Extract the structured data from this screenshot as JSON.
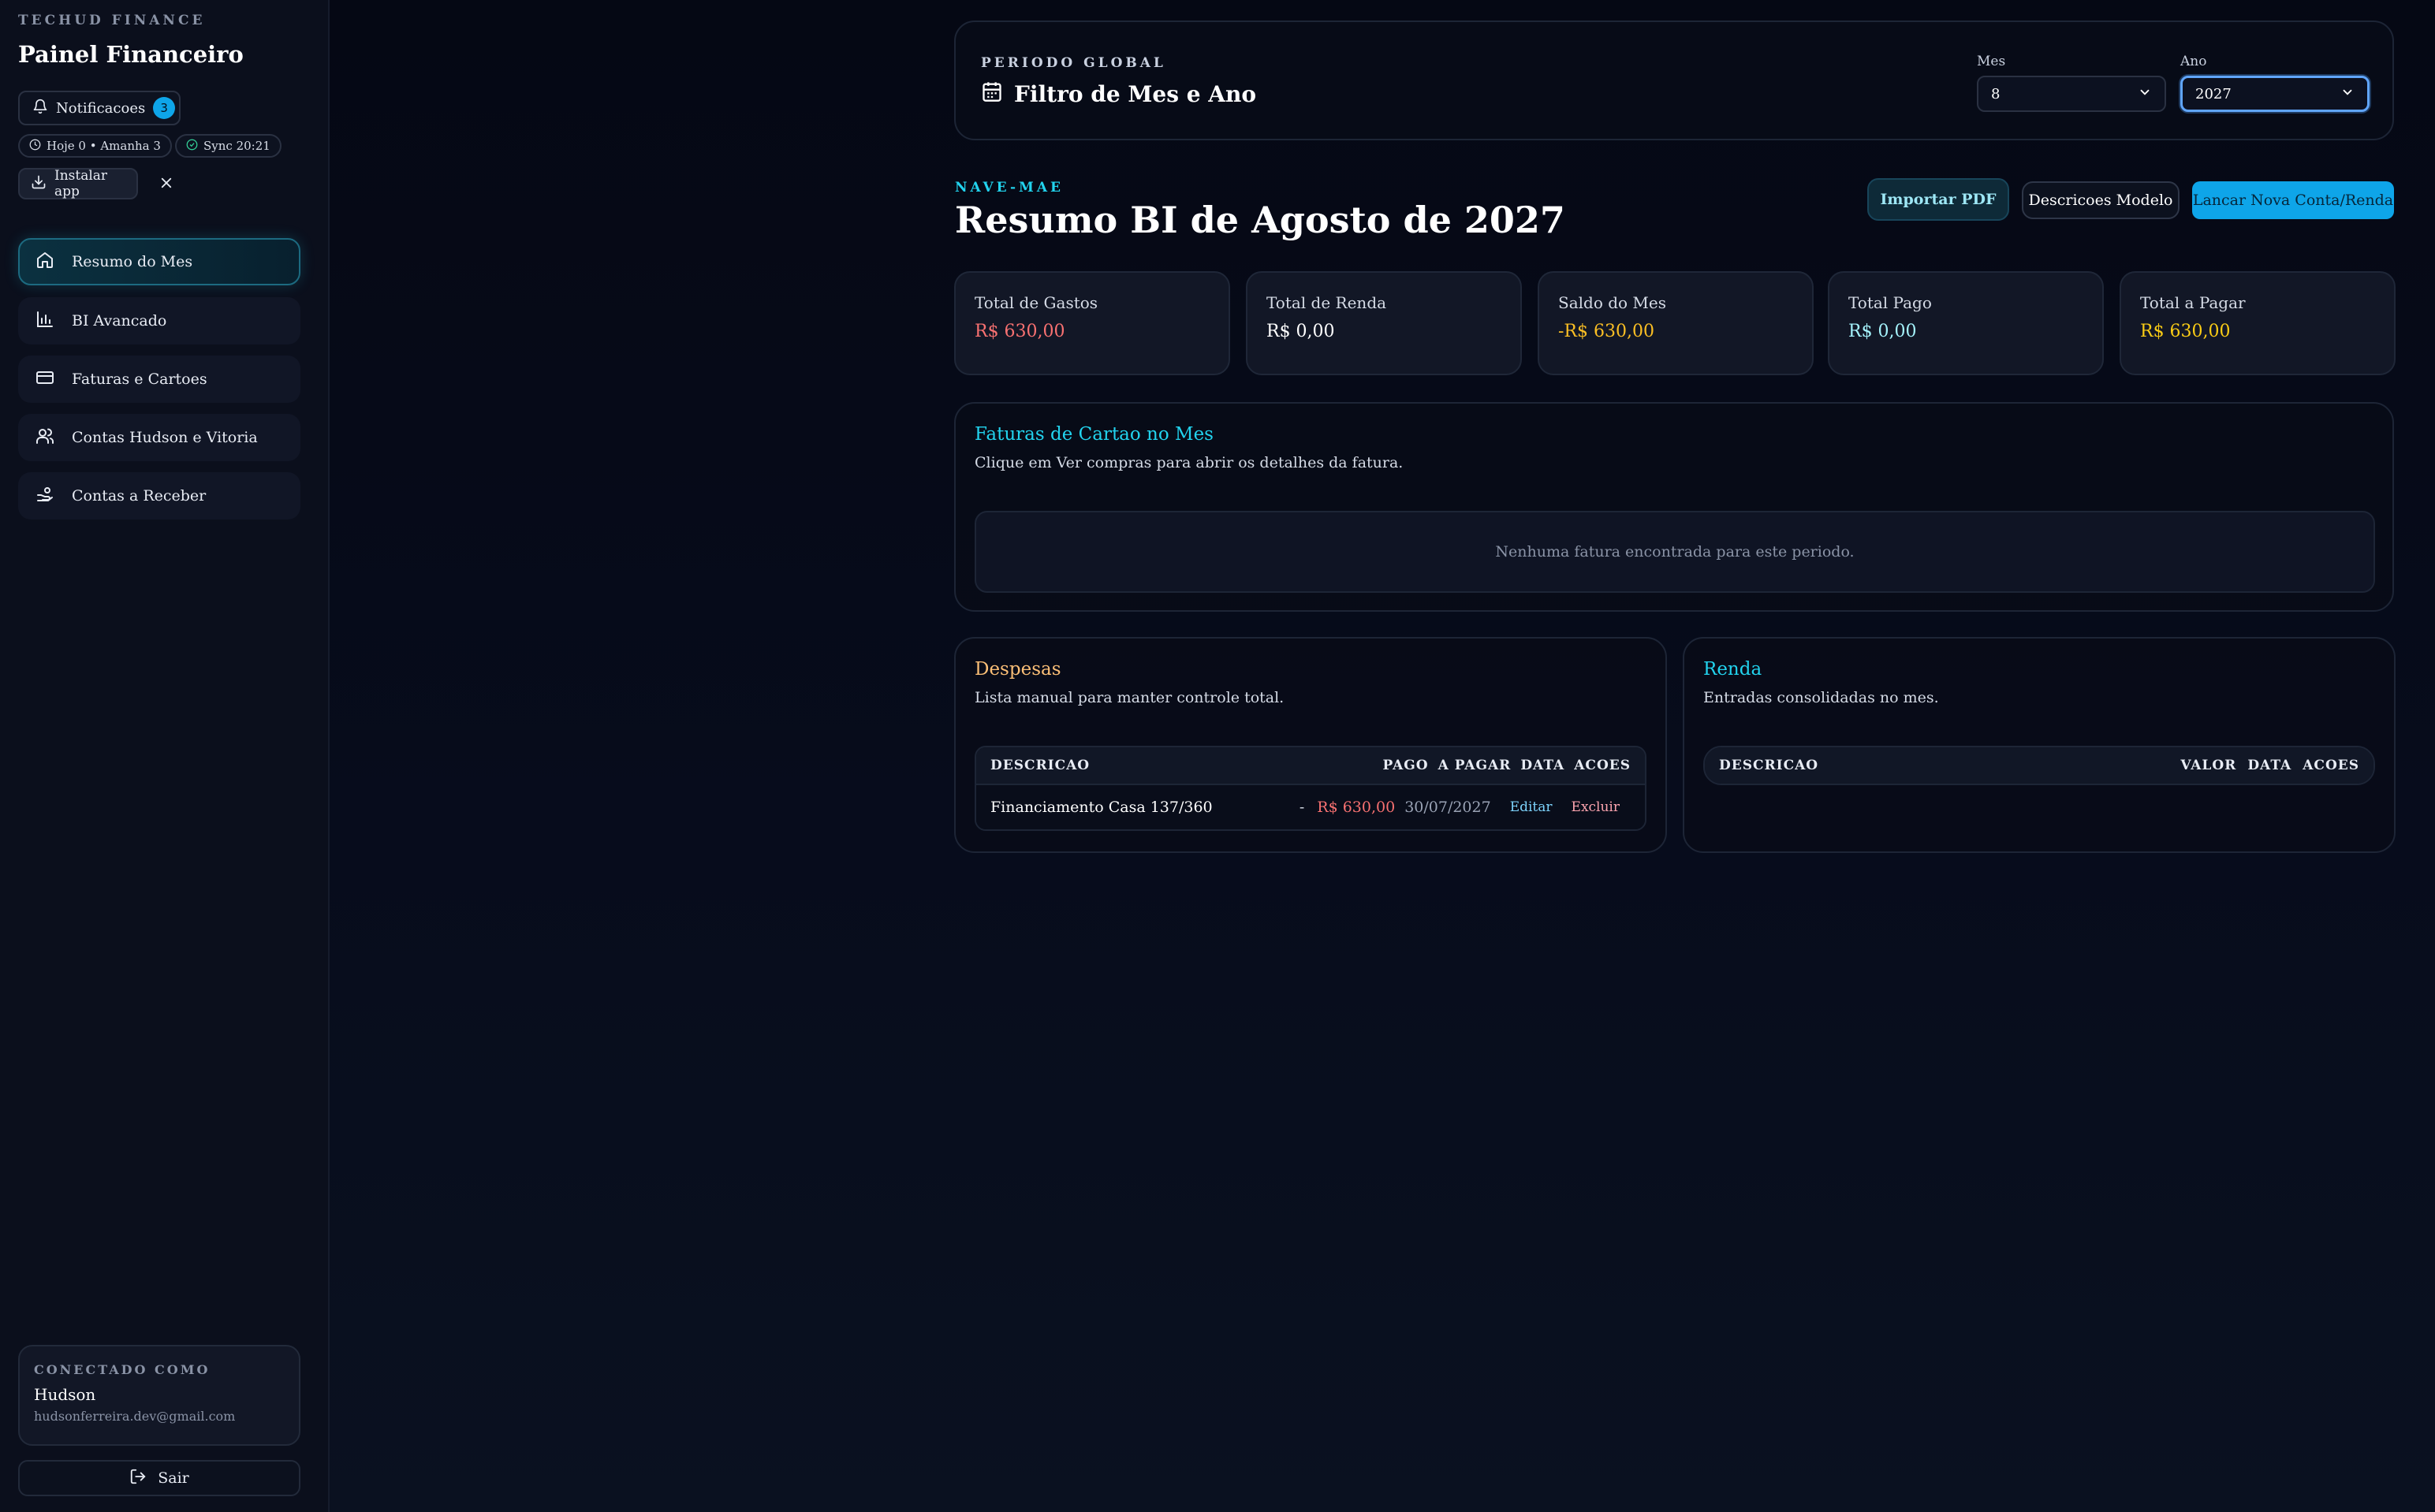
{
  "sidebar": {
    "brand_kicker": "TECHUD FINANCE",
    "brand_title": "Painel Financeiro",
    "notifications_label": "Notificacoes",
    "notifications_count": "3",
    "today_pill": "Hoje 0 • Amanha 3",
    "sync_pill": "Sync 20:21",
    "install_label": "Instalar app",
    "nav": [
      {
        "label": "Resumo do Mes",
        "icon": "home-icon",
        "active": true
      },
      {
        "label": "BI Avancado",
        "icon": "bar-chart-icon",
        "active": false
      },
      {
        "label": "Faturas e Cartoes",
        "icon": "credit-card-icon",
        "active": false
      },
      {
        "label": "Contas Hudson e Vitoria",
        "icon": "users-icon",
        "active": false
      },
      {
        "label": "Contas a Receber",
        "icon": "hand-coins-icon",
        "active": false
      }
    ],
    "user": {
      "kicker": "CONECTADO COMO",
      "name": "Hudson",
      "email": "hudsonferreira.dev@gmail.com"
    },
    "logout_label": "Sair"
  },
  "filter": {
    "kicker": "PERIODO GLOBAL",
    "title": "Filtro de Mes e Ano",
    "month_label": "Mes",
    "month_value": "8",
    "year_label": "Ano",
    "year_value": "2027"
  },
  "header": {
    "kicker": "NAVE-MAE",
    "title": "Resumo BI de Agosto de 2027",
    "import_label": "Importar PDF",
    "descriptions_label": "Descricoes Modelo",
    "new_label": "Lancar Nova Conta/Renda"
  },
  "kpis": [
    {
      "label": "Total de Gastos",
      "value": "R$ 630,00",
      "color": "#f87171"
    },
    {
      "label": "Total de Renda",
      "value": "R$ 0,00",
      "color": "#ffffff"
    },
    {
      "label": "Saldo do Mes",
      "value": "-R$ 630,00",
      "color": "#fbbf24"
    },
    {
      "label": "Total Pago",
      "value": "R$ 0,00",
      "color": "#a5f3fc"
    },
    {
      "label": "Total a Pagar",
      "value": "R$ 630,00",
      "color": "#facc15"
    }
  ],
  "faturas": {
    "title": "Faturas de Cartao no Mes",
    "desc": "Clique em Ver compras para abrir os detalhes da fatura.",
    "empty": "Nenhuma fatura encontrada para este periodo."
  },
  "despesas": {
    "title": "Despesas",
    "desc": "Lista manual para manter controle total.",
    "columns": [
      "DESCRICAO",
      "PAGO",
      "A PAGAR",
      "DATA",
      "ACOES"
    ],
    "rows": [
      {
        "descricao": "Financiamento Casa 137/360",
        "pago": "-",
        "a_pagar": "R$ 630,00",
        "data": "30/07/2027",
        "edit": "Editar",
        "delete": "Excluir"
      }
    ]
  },
  "renda": {
    "title": "Renda",
    "desc": "Entradas consolidadas no mes.",
    "columns": [
      "DESCRICAO",
      "VALOR",
      "DATA",
      "ACOES"
    ]
  },
  "colors": {
    "accent": "#22d3ee",
    "primary_button": "#0ea5e9",
    "expense_title": "#fbbf77",
    "income_title": "#22d3ee",
    "danger": "#f87171"
  }
}
